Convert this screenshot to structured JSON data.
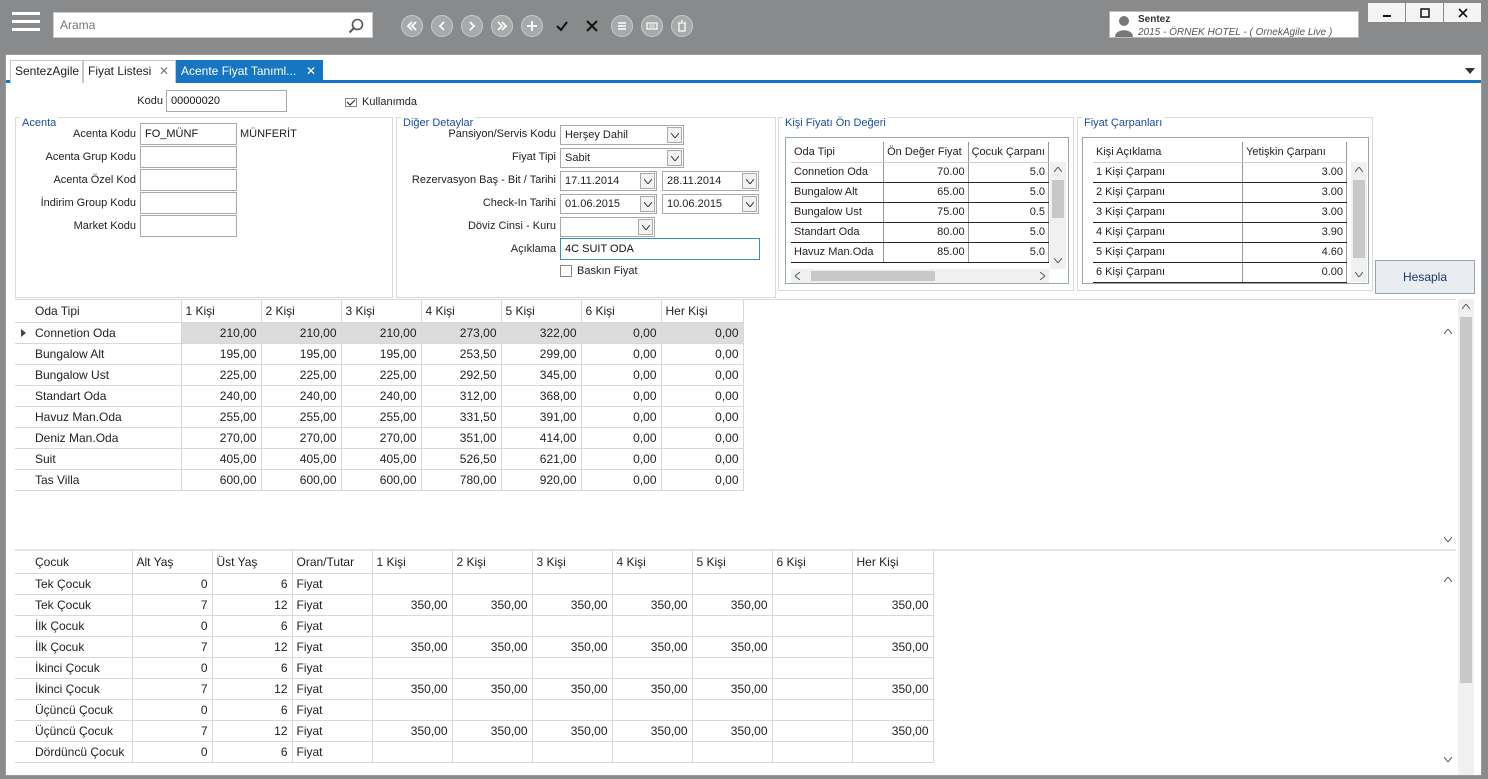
{
  "search": {
    "placeholder": "Arama"
  },
  "toolbar": {
    "icons": [
      "first-icon",
      "prev-icon",
      "next-icon",
      "last-icon",
      "add-icon",
      "check-icon",
      "close-icon",
      "list-icon",
      "keyboard-icon",
      "trash-icon"
    ]
  },
  "user": {
    "name": "Sentez",
    "sub": "2015 - ÖRNEK HOTEL - ( OrnekAgile Live )"
  },
  "tabs": [
    {
      "label": "SentezAgile"
    },
    {
      "label": "Fiyat Listesi",
      "close": "✕"
    },
    {
      "label": "Acente Fiyat Tanıml...",
      "close": "✕"
    }
  ],
  "form": {
    "kodu_label": "Kodu",
    "kodu_value": "00000020",
    "kullanimda_label": "Kullanımda",
    "acenta_title": "Acenta",
    "acenta_kodu_label": "Acenta Kodu",
    "acenta_kodu_value": "FO_MÜNF",
    "acenta_kodu_desc": "MÜNFERİT",
    "acenta_grup_label": "Acenta Grup Kodu",
    "acenta_ozel_label": "Acenta Özel Kod",
    "indirim_label": "İndirim Group Kodu",
    "market_label": "Market Kodu",
    "diger_title": "Diğer Detaylar",
    "pansiyon_label": "Pansiyon/Servis Kodu",
    "pansiyon_value": "Herşey Dahil",
    "fiyat_tipi_label": "Fiyat Tipi",
    "fiyat_tipi_value": "Sabit",
    "rez_label": "Rezervasyon Baş - Bit / Tarihi",
    "rez_start": "17.11.2014",
    "rez_end": "28.11.2014",
    "checkin_label": "Check-In Tarihi",
    "checkin_start": "01.06.2015",
    "checkin_end": "10.06.2015",
    "doviz_label": "Döviz Cinsi - Kuru",
    "aciklama_label": "Açıklama",
    "aciklama_value": "4C SUIT ODA",
    "baskin_label": "Baskın Fiyat"
  },
  "kisi_fiyati": {
    "title": "Kişi Fiyatı Ön Değeri",
    "headers": [
      "Oda Tipi",
      "Ön Değer Fiyat",
      "Çocuk Çarpanı"
    ],
    "rows": [
      [
        "Connetion Oda",
        "70.00",
        "5.0"
      ],
      [
        "Bungalow Alt",
        "65.00",
        "5.0"
      ],
      [
        "Bungalow Ust",
        "75.00",
        "0.5"
      ],
      [
        "Standart Oda",
        "80.00",
        "5.0"
      ],
      [
        "Havuz Man.Oda",
        "85.00",
        "5.0"
      ]
    ]
  },
  "carpanlar": {
    "title": "Fiyat Çarpanları",
    "headers": [
      "Kişi Açıklama",
      "Yetişkin Çarpanı"
    ],
    "rows": [
      [
        "1 Kişi Çarpanı",
        "3.00"
      ],
      [
        "2 Kişi Çarpanı",
        "3.00"
      ],
      [
        "3 Kişi Çarpanı",
        "3.00"
      ],
      [
        "4 Kişi Çarpanı",
        "3.90"
      ],
      [
        "5 Kişi Çarpanı",
        "4.60"
      ],
      [
        "6 Kişi Çarpanı",
        "0.00"
      ]
    ]
  },
  "hesapla_label": "Hesapla",
  "oda_grid": {
    "headers": [
      "Oda Tipi",
      "1 Kişi",
      "2 Kişi",
      "3 Kişi",
      "4 Kişi",
      "5 Kişi",
      "6 Kişi",
      "Her Kişi"
    ],
    "rows": [
      [
        "Connetion Oda",
        "210,00",
        "210,00",
        "210,00",
        "273,00",
        "322,00",
        "0,00",
        "0,00"
      ],
      [
        "Bungalow Alt",
        "195,00",
        "195,00",
        "195,00",
        "253,50",
        "299,00",
        "0,00",
        "0,00"
      ],
      [
        "Bungalow Ust",
        "225,00",
        "225,00",
        "225,00",
        "292,50",
        "345,00",
        "0,00",
        "0,00"
      ],
      [
        "Standart Oda",
        "240,00",
        "240,00",
        "240,00",
        "312,00",
        "368,00",
        "0,00",
        "0,00"
      ],
      [
        "Havuz Man.Oda",
        "255,00",
        "255,00",
        "255,00",
        "331,50",
        "391,00",
        "0,00",
        "0,00"
      ],
      [
        "Deniz Man.Oda",
        "270,00",
        "270,00",
        "270,00",
        "351,00",
        "414,00",
        "0,00",
        "0,00"
      ],
      [
        "Suit",
        "405,00",
        "405,00",
        "405,00",
        "526,50",
        "621,00",
        "0,00",
        "0,00"
      ],
      [
        "Tas Villa",
        "600,00",
        "600,00",
        "600,00",
        "780,00",
        "920,00",
        "0,00",
        "0,00"
      ]
    ]
  },
  "cocuk_grid": {
    "headers": [
      "Çocuk",
      "Alt Yaş",
      "Üst Yaş",
      "Oran/Tutar",
      "1 Kişi",
      "2 Kişi",
      "3 Kişi",
      "4 Kişi",
      "5 Kişi",
      "6 Kişi",
      "Her Kişi"
    ],
    "rows": [
      [
        "Tek Çocuk",
        "0",
        "6",
        "Fiyat",
        "",
        "",
        "",
        "",
        "",
        "",
        ""
      ],
      [
        "Tek Çocuk",
        "7",
        "12",
        "Fiyat",
        "350,00",
        "350,00",
        "350,00",
        "350,00",
        "350,00",
        "",
        "350,00"
      ],
      [
        "İlk Çocuk",
        "0",
        "6",
        "Fiyat",
        "",
        "",
        "",
        "",
        "",
        "",
        ""
      ],
      [
        "İlk Çocuk",
        "7",
        "12",
        "Fiyat",
        "350,00",
        "350,00",
        "350,00",
        "350,00",
        "350,00",
        "",
        "350,00"
      ],
      [
        "İkinci Çocuk",
        "0",
        "6",
        "Fiyat",
        "",
        "",
        "",
        "",
        "",
        "",
        ""
      ],
      [
        "İkinci Çocuk",
        "7",
        "12",
        "Fiyat",
        "350,00",
        "350,00",
        "350,00",
        "350,00",
        "350,00",
        "",
        "350,00"
      ],
      [
        "Üçüncü Çocuk",
        "0",
        "6",
        "Fiyat",
        "",
        "",
        "",
        "",
        "",
        "",
        ""
      ],
      [
        "Üçüncü Çocuk",
        "7",
        "12",
        "Fiyat",
        "350,00",
        "350,00",
        "350,00",
        "350,00",
        "350,00",
        "",
        "350,00"
      ],
      [
        "Dördüncü Çocuk",
        "0",
        "6",
        "Fiyat",
        "",
        "",
        "",
        "",
        "",
        "",
        ""
      ]
    ]
  }
}
